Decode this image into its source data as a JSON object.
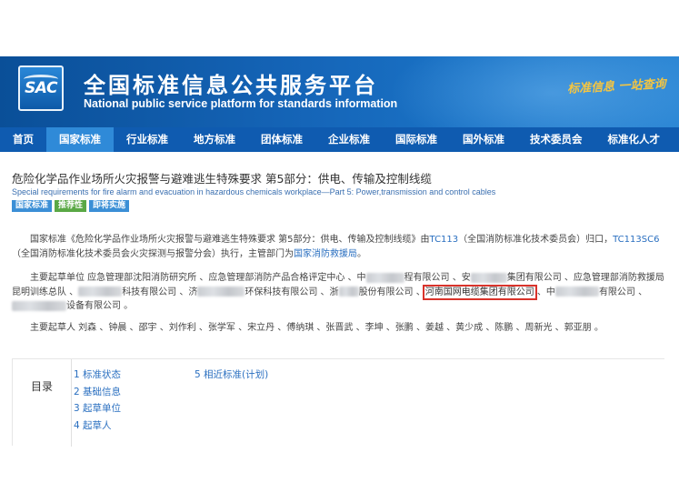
{
  "header": {
    "logo_text": "SAC",
    "title_cn": "全国标准信息公共服务平台",
    "title_en": "National public service platform  for standards information",
    "slogan": "标准信息 一站查询"
  },
  "nav": {
    "items": [
      {
        "label": "首页"
      },
      {
        "label": "国家标准"
      },
      {
        "label": "行业标准"
      },
      {
        "label": "地方标准"
      },
      {
        "label": "团体标准"
      },
      {
        "label": "企业标准"
      },
      {
        "label": "国际标准"
      },
      {
        "label": "国外标准"
      },
      {
        "label": "技术委员会"
      },
      {
        "label": "标准化人才"
      }
    ],
    "active_index": 1
  },
  "standard": {
    "title_cn": "危险化学品作业场所火灾报警与避难逃生特殊要求 第5部分：供电、传输及控制线缆",
    "title_en": "Special requirements for fire alarm and evacuation in hazardous chemicals workplace—Part 5: Power,transmission and control cables",
    "badges": [
      "国家标准",
      "推荐性",
      "即将实施"
    ]
  },
  "intro": {
    "t1": "国家标准《危险化学品作业场所火灾报警与避难逃生特殊要求 第5部分：供电、传输及控制线缆》由",
    "link_tc113": "TC113",
    "t2": "（全国消防标准化技术委员会）归口，",
    "link_tc113sc6": "TC113SC6",
    "t3": "（全国消防标准化技术委员会火灾探测与报警分会）执行，主管部门为",
    "link_dept": "国家消防救援局",
    "t4": "。"
  },
  "drafting_units": {
    "u1": "主要起草单位 应急管理部沈阳消防研究所 、应急管理部消防产品合格评定中心 、中",
    "u2": "程有限公司 、安",
    "u3": "集团有限公司 、应急管理部消防救援局昆明训练总队 、",
    "u4": "科技有限公司 、济",
    "u5": "环保科技有限公司 、浙",
    "u6": "股份有限公司 、",
    "highlight": "河南国网电缆集团有限公司",
    "u7": " 、中",
    "u8": "有限公司 、",
    "u9": "设备有限公司 。"
  },
  "drafters": {
    "text": "主要起草人 刘森 、钟晨 、邵宇 、刘作利 、张学军 、宋立丹 、傅纳琪 、张晋武 、李坤 、张鹏 、姜越 、黄少成 、陈鹏 、周新光 、郭亚朋 。"
  },
  "toc": {
    "label": "目录",
    "col1": [
      "1  标准状态",
      "2  基础信息",
      "3  起草单位",
      "4  起草人"
    ],
    "col2": [
      "5  相近标准(计划)"
    ]
  }
}
